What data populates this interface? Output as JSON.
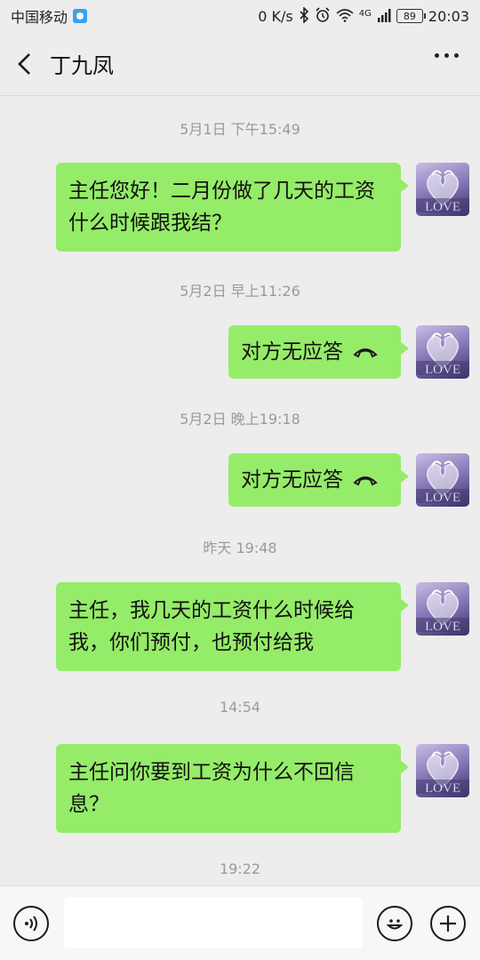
{
  "status_bar": {
    "carrier": "中国移动",
    "net_speed": "0 K/s",
    "network_type": "4G",
    "battery": "89",
    "time": "20:03",
    "icons": [
      "carrier-app-icon",
      "bluetooth-icon",
      "alarm-icon",
      "wifi-icon",
      "signal-icon",
      "battery-icon"
    ]
  },
  "header": {
    "title": "丁九凤",
    "back_icon": "chevron-left-icon",
    "more_icon": "more-dots-icon"
  },
  "messages": [
    {
      "timestamp": "5月1日 下午15:49",
      "text": "主任您好！二月份做了几天的工资什么时候跟我结？",
      "type": "text"
    },
    {
      "timestamp": "5月2日 早上11:26",
      "text": "对方无应答",
      "type": "voice-call"
    },
    {
      "timestamp": "5月2日 晚上19:18",
      "text": "对方无应答",
      "type": "voice-call"
    },
    {
      "timestamp": "昨天 19:48",
      "text": "主任，我几天的工资什么时候给我，你们预付，也预付给我",
      "type": "text"
    },
    {
      "timestamp": "14:54",
      "text": "主任问你要到工资为什么不回信息？",
      "type": "text"
    },
    {
      "timestamp": "19:22"
    }
  ],
  "avatar_icon": "love-swans-avatar",
  "input_bar": {
    "voice_icon": "voice-icon",
    "emoji_icon": "emoji-icon",
    "plus_icon": "plus-icon",
    "text_value": ""
  },
  "colors": {
    "bubble": "#95ec69",
    "background": "#ededed",
    "timestamp": "#9a9a9a"
  }
}
